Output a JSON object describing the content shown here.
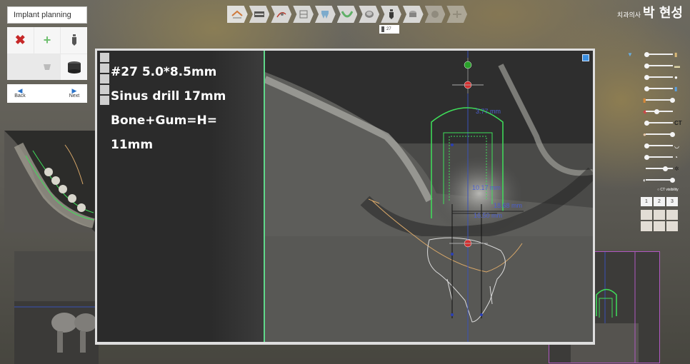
{
  "panel": {
    "title": "Implant planning",
    "back_label": "Back",
    "next_label": "Next"
  },
  "brand": {
    "prefix": "치과의사",
    "name": "박 현성"
  },
  "toolbar": {
    "items": [
      "home-icon",
      "panoramic-icon",
      "nerve-icon",
      "section-icon",
      "tooth-icon",
      "arch-icon",
      "crown-icon",
      "implant-icon",
      "abutment-icon",
      "sleeve-icon",
      "guide-icon"
    ]
  },
  "tooth_tag": {
    "label": "27"
  },
  "notes": {
    "line1": "#27 5.0*8.5mm",
    "line2": "Sinus drill 17mm",
    "line3": "Bone+Gum=H=",
    "line4": "11mm"
  },
  "measurements": {
    "m1": "3.77 mm",
    "m2": "10.17 mm",
    "m3": "18.68 mm",
    "m4": "16.50 mm"
  },
  "right_panel": {
    "ct_label": "CT",
    "ct_visibility_label": "CT visibility",
    "views": [
      "1",
      "2",
      "3"
    ]
  },
  "colors": {
    "implant_outline": "#3fe05a",
    "measure_text": "#4b5fd0",
    "nerve_curve": "#d9a869",
    "selection_frame": "#b057c2"
  }
}
